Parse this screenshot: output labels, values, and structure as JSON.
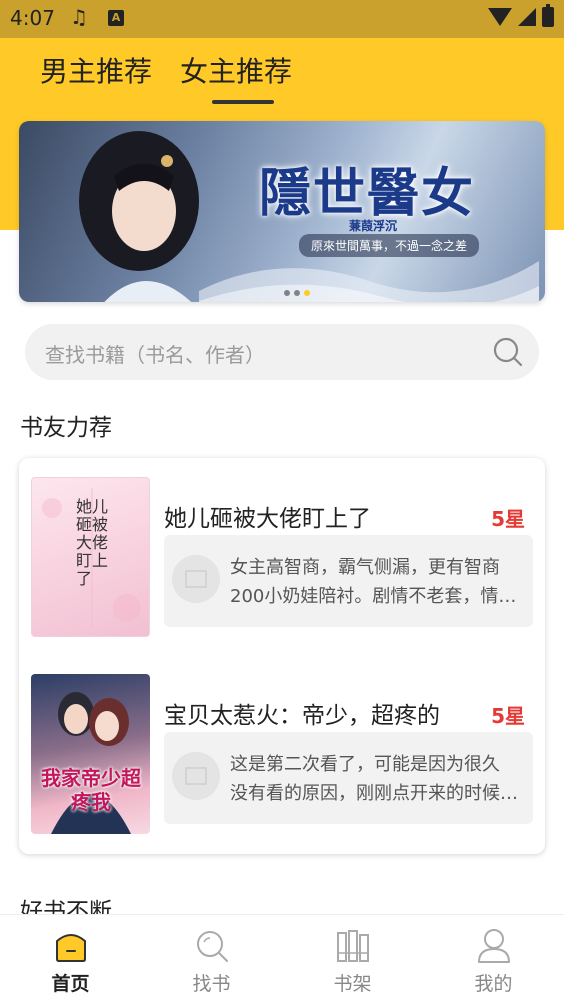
{
  "status_bar": {
    "time": "4:07",
    "notif_letter": "A"
  },
  "tabs": [
    {
      "label": "男主推荐",
      "active": false
    },
    {
      "label": "女主推荐",
      "active": true
    }
  ],
  "banner": {
    "title": "隱世醫女",
    "author": "蒹葭浮沉",
    "tagline": "原來世間萬事，不過一念之差",
    "page_count": 3,
    "active_page": 3
  },
  "search": {
    "placeholder": "查找书籍（书名、作者）"
  },
  "recommend": {
    "section_title": "书友力荐",
    "books": [
      {
        "title": "她儿砸被大佬盯上了",
        "rating": "5星",
        "review_lines": [
          "女主高智商，霸气侧漏，更有智商",
          "200小奶娃陪衬。剧情不老套，情…"
        ],
        "cover_title": "她儿砸被大佬盯上了"
      },
      {
        "title": "宝贝太惹火：帝少，超疼的",
        "rating": "5星",
        "review_lines": [
          "这是第二次看了，可能是因为很久",
          "没有看的原因，刚刚点开来的时候…"
        ],
        "cover_title": "我家帝少超疼我"
      }
    ]
  },
  "next_section_title": "好书不断",
  "bottom_nav": [
    {
      "label": "首页",
      "icon": "home-icon",
      "active": true
    },
    {
      "label": "找书",
      "icon": "search-icon",
      "active": false
    },
    {
      "label": "书架",
      "icon": "bookshelf-icon",
      "active": false
    },
    {
      "label": "我的",
      "icon": "profile-icon",
      "active": false
    }
  ],
  "colors": {
    "accent": "#FFC928",
    "rating": "#E53935"
  }
}
